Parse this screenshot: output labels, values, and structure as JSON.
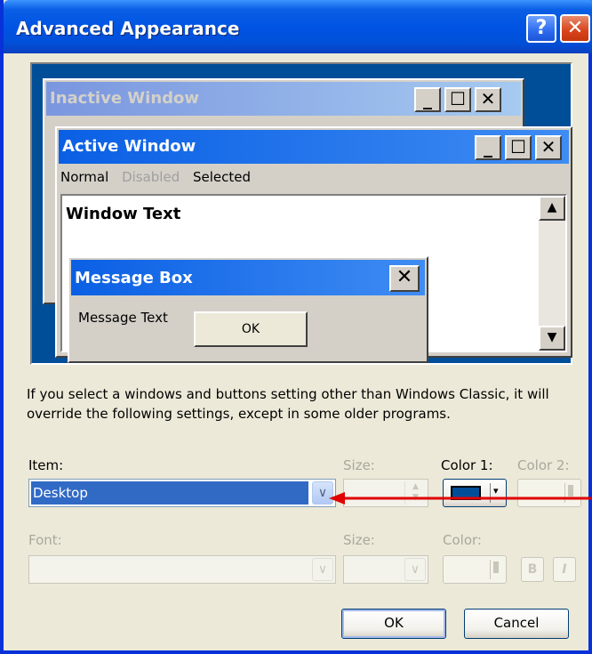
{
  "dialog": {
    "title": "Advanced Appearance",
    "help_glyph": "?",
    "close_glyph": "✕"
  },
  "preview": {
    "inactive_title": "Inactive Window",
    "active_title": "Active Window",
    "menu": {
      "normal": "Normal",
      "disabled": "Disabled",
      "selected": "Selected"
    },
    "window_text": "Window Text",
    "message_box_title": "Message Box",
    "message_text": "Message Text",
    "ok_label": "OK",
    "min_glyph": "_",
    "max_glyph": "☐",
    "close_glyph": "✕",
    "scroll_up": "▲",
    "scroll_down": "▼"
  },
  "info_text": "If you select a windows and buttons setting other than Windows Classic, it will override the following settings, except in some older programs.",
  "item_row": {
    "item_label": "Item:",
    "item_value": "Desktop",
    "size_label": "Size:",
    "color1_label": "Color 1:",
    "color2_label": "Color 2:",
    "color1_value": "#004E98"
  },
  "font_row": {
    "font_label": "Font:",
    "size_label": "Size:",
    "color_label": "Color:",
    "bold_label": "B",
    "italic_label": "I"
  },
  "buttons": {
    "ok": "OK",
    "cancel": "Cancel"
  },
  "annotation": {
    "arrow_color": "#E00000"
  }
}
